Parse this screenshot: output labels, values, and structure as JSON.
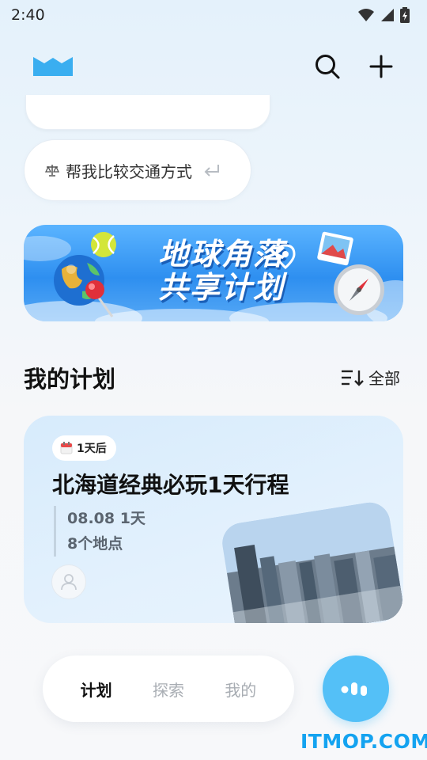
{
  "status_bar": {
    "time": "2:40"
  },
  "suggestion": {
    "icon": "scale-icon",
    "text": "帮我比较交通方式"
  },
  "banner": {
    "line1": "地球角落",
    "line2": "共享计划"
  },
  "section": {
    "title": "我的计划",
    "all_label": "全部"
  },
  "plan_card": {
    "badge": "1天后",
    "title": "北海道经典必玩1天行程",
    "date_days": "08.08 1天",
    "places": "8个地点"
  },
  "tabs": [
    "计划",
    "探索",
    "我的"
  ],
  "watermark": "ITMOP.COM",
  "colors": {
    "accent": "#54c0f7",
    "banner_blue": "#2e8ff0",
    "logo": "#3aaef0"
  }
}
